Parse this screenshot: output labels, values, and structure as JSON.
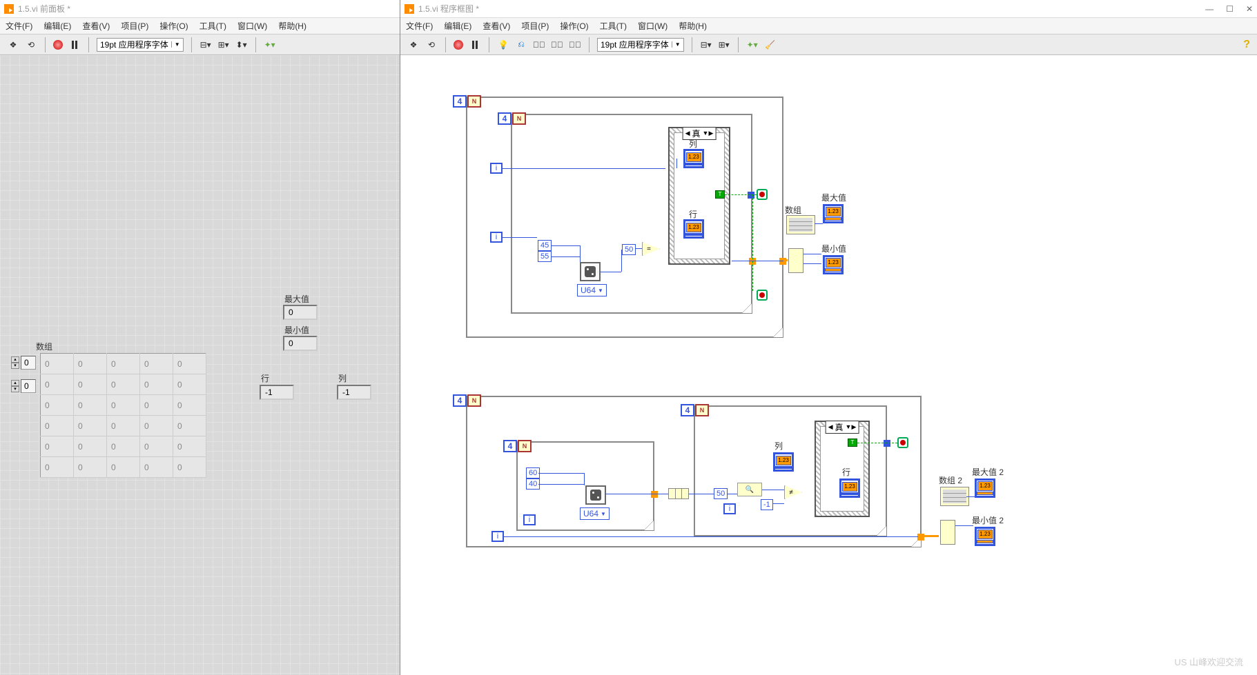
{
  "fp": {
    "title": "1.5.vi 前面板 *",
    "menus": [
      "文件(F)",
      "编辑(E)",
      "查看(V)",
      "项目(P)",
      "操作(O)",
      "工具(T)",
      "窗口(W)",
      "帮助(H)"
    ],
    "font": "19pt 应用程序字体",
    "labels": {
      "array": "数组",
      "max": "最大值",
      "min": "最小值",
      "row": "行",
      "col": "列"
    },
    "row_idx": "0",
    "col_idx": "0",
    "max_val": "0",
    "min_val": "0",
    "row_val": "-1",
    "col_val": "-1",
    "cell": "0"
  },
  "bd": {
    "title": "1.5.vi 程序框图 *",
    "menus": [
      "文件(F)",
      "编辑(E)",
      "查看(V)",
      "项目(P)",
      "操作(O)",
      "工具(T)",
      "窗口(W)",
      "帮助(H)"
    ],
    "font": "19pt 应用程序字体",
    "outer_N": "4",
    "inner_N": "4",
    "rand_lo": "45",
    "rand_hi": "55",
    "cmp_const": "50",
    "u64": "U64",
    "case_true": "真",
    "labels": {
      "col": "列",
      "row": "行",
      "array": "数组",
      "max": "最大值",
      "min": "最小值",
      "array2": "数组 2",
      "max2": "最大值 2",
      "min2": "最小值 2"
    },
    "lo2": "60",
    "hi2": "40",
    "cmp2": "50",
    "neg1": "-1"
  },
  "term_icon": "1.23",
  "watermark": "US 山峰欢迎交流"
}
